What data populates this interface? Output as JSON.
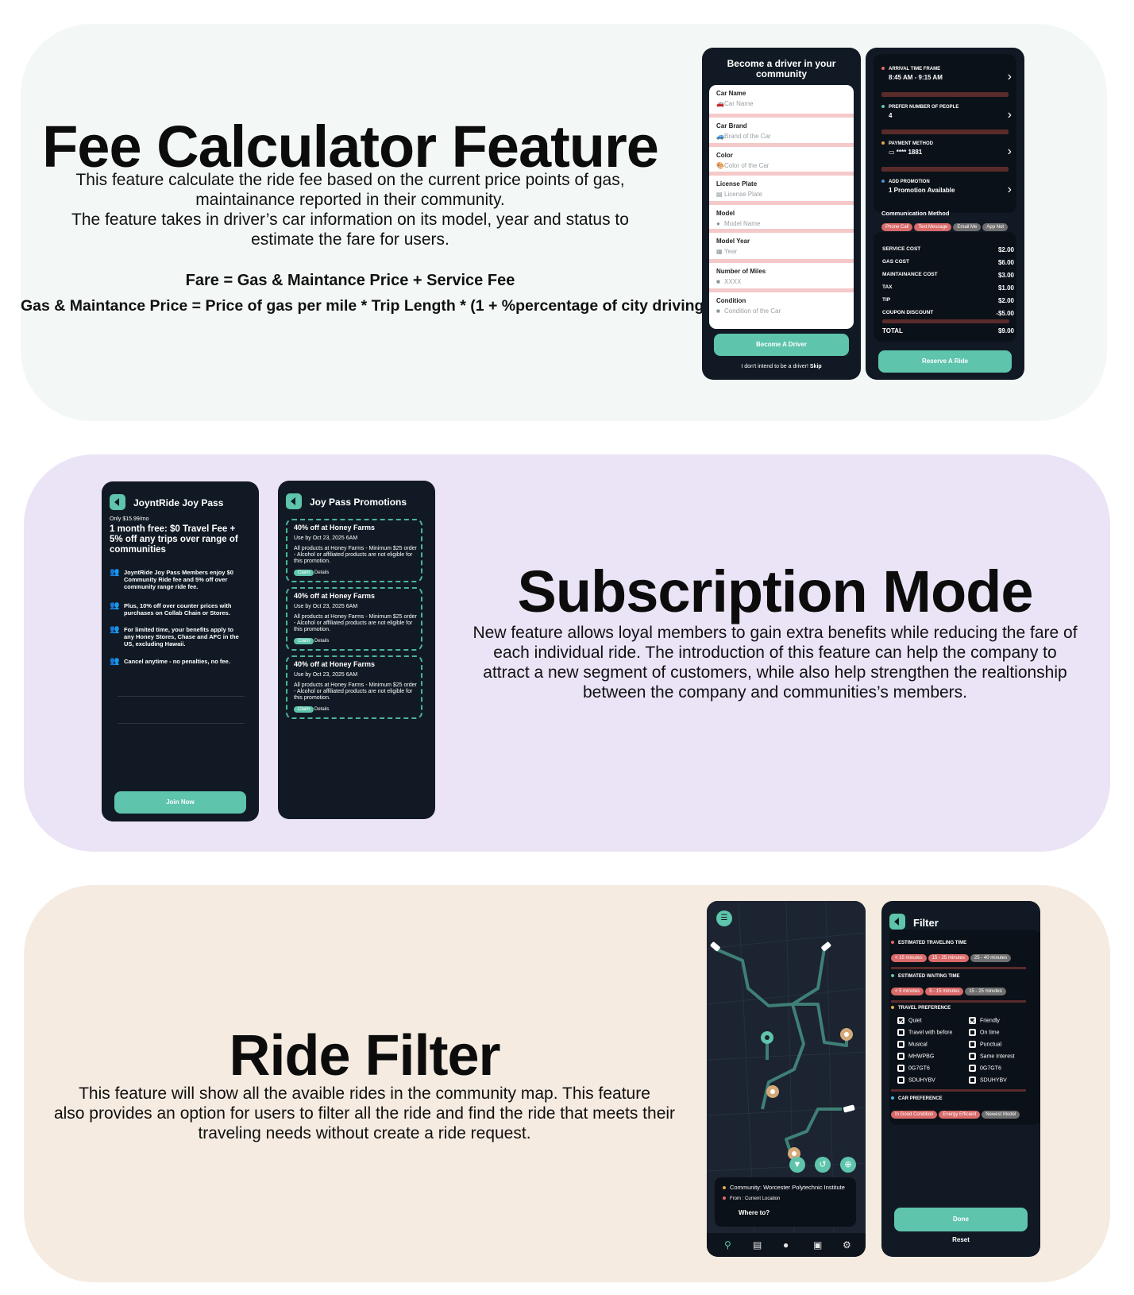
{
  "fee_section": {
    "title": "Fee Calculator Feature",
    "description_lines": [
      "This feature calculate the ride fee based on the current price points of gas,",
      "maintainance reported in their community.",
      "The feature takes in driver’s car information on its model, year and status to",
      "estimate the fare for users."
    ],
    "formula_1": "Fare = Gas & Maintance Price + Service Fee",
    "formula_2": "Gas & Maintance Price = Price of gas per mile * Trip Length * (1 + %percentage of city driving)"
  },
  "driver_phone": {
    "title": "Become a driver in your community",
    "fields": [
      {
        "label": "Car Name",
        "placeholder": "Car Name",
        "icon": "car-icon"
      },
      {
        "label": "Car Brand",
        "placeholder": "Brand of the Car",
        "icon": "car-icon"
      },
      {
        "label": "Color",
        "placeholder": "Color of the Car",
        "icon": "palette-icon"
      },
      {
        "label": "License Plate",
        "placeholder": "License Plate",
        "icon": "id-card-icon"
      },
      {
        "label": "Model",
        "placeholder": "Model Name",
        "icon": "pin-icon"
      },
      {
        "label": "Model Year",
        "placeholder": "Year",
        "icon": "calendar-icon"
      },
      {
        "label": "Number of Miles",
        "placeholder": "XXXX",
        "icon": "lock-icon"
      },
      {
        "label": "Condition",
        "placeholder": "Condition of the Car",
        "icon": "lock-icon"
      }
    ],
    "button": "Become A Driver",
    "skip_text": "I don't intend to be a driver!",
    "skip_link": "Skip"
  },
  "reserve_phone": {
    "rows": [
      {
        "label": "ARRIVAL TIME FRAME",
        "value": "8:45 AM - 9:15 AM",
        "dot_color": "#e06a6a"
      },
      {
        "label": "PREFER NUMBER OF PEOPLE",
        "value": "4",
        "dot_color": "#5ec4ac"
      },
      {
        "label": "PAYMENT METHOD",
        "value": "**** 1881",
        "dot_color": "#e6a64a"
      },
      {
        "label": "ADD PROMOTION",
        "value": "1 Promotion Available",
        "dot_color": "#4a8fd9"
      }
    ],
    "comm_title": "Communication Method",
    "comm_options": [
      "Phone Call",
      "Text Message",
      "Email Me",
      "App Not"
    ],
    "costs": [
      {
        "label": "SERVICE COST",
        "value": "$2.00"
      },
      {
        "label": "GAS COST",
        "value": "$6.00"
      },
      {
        "label": "MAINTAINANCE COST",
        "value": "$3.00"
      },
      {
        "label": "TAX",
        "value": "$1.00"
      },
      {
        "label": "TIP",
        "value": "$2.00"
      },
      {
        "label": "COUPON DISCOUNT",
        "value": "-$5.00"
      }
    ],
    "total_label": "TOTAL",
    "total_value": "$9.00",
    "button": "Reserve A Ride"
  },
  "subscription_section": {
    "title": "Subscription Mode",
    "description_lines": [
      "New feature allows loyal members to gain extra benefits while reducing the fare of",
      "each individual ride. The introduction of this feature can help the company to",
      "attract a new segment of customers, while also help strengthen the realtionship",
      "between the company and communities’s members."
    ]
  },
  "joypass_phone": {
    "title": "JoyntRide Joy Pass",
    "price": "Only $15.99/mo",
    "headline": "1 month free: $0 Travel Fee + 5% off any trips over range of communities",
    "benefits": [
      "JoyntRide Joy Pass Members enjoy $0 Community Ride fee and 5% off over community range ride fee.",
      "Plus, 10% off over counter prices with purchases on Collab Chain or Stores.",
      "For limited time, your benefits apply to any Honey Stores, Chase and AFC in the US, excluding Hawaii.",
      "Cancel anytime - no penalties, no fee."
    ],
    "button": "Join Now"
  },
  "promotions_phone": {
    "title": "Joy Pass Promotions",
    "promos": [
      {
        "title": "40% off at Honey Farms",
        "date": "Use by Oct 23, 2025 6AM",
        "body": "All products at Honey Farms - Minimum $25 order - Alcohol or affiliated products are not eligible for this promotion.",
        "claim": "Claim",
        "details": "Details"
      },
      {
        "title": "40% off at Honey Farms",
        "date": "Use by Oct 23, 2025 6AM",
        "body": "All products at Honey Farms - Minimum $25 order - Alcohol or affiliated products are not eligible for this promotion.",
        "claim": "Claim",
        "details": "Details"
      },
      {
        "title": "40% off at Honey Farms",
        "date": "Use by Oct 23, 2025 6AM",
        "body": "All products at Honey Farms - Minimum $25 order - Alcohol or affiliated products are not eligible for this promotion.",
        "claim": "Claim",
        "details": "Details"
      }
    ]
  },
  "filter_section": {
    "title": "Ride Filter",
    "description_lines": [
      "This feature will show all the avaible rides in the community map. This feature",
      "also provides an option for users to filter all the ride and find the ride that meets their",
      "traveling needs without create a ride request."
    ]
  },
  "map_phone": {
    "community": "Community: Worcester Polytechnic Institute",
    "from": "From : Current Location",
    "where_to": "Where to?"
  },
  "filter_phone": {
    "title": "Filter",
    "travel_time_title": "ESTIMATED TRAVELING TIME",
    "travel_time_options": [
      "< 15 minutes",
      "15 - 25 minutes",
      "25 - 40 minutes"
    ],
    "wait_time_title": "ESTIMATED WAITING TIME",
    "wait_time_options": [
      "< 5 minutes",
      "5 - 15 minutes",
      "15 - 25 minutes"
    ],
    "travel_pref_title": "TRAVEL PREFERENCE",
    "travel_pref_left": [
      {
        "label": "Quiet",
        "checked": true
      },
      {
        "label": "Travel with before",
        "checked": false
      },
      {
        "label": "Musical",
        "checked": false
      },
      {
        "label": "MHWPBG",
        "checked": false
      },
      {
        "label": "0G7GT6",
        "checked": false
      },
      {
        "label": "SDUHYBV",
        "checked": false
      }
    ],
    "travel_pref_right": [
      {
        "label": "Friendly",
        "checked": true
      },
      {
        "label": "On time",
        "checked": false
      },
      {
        "label": "Punctual",
        "checked": false
      },
      {
        "label": "Same Interest",
        "checked": false
      },
      {
        "label": "0G7GT6",
        "checked": false
      },
      {
        "label": "SDUHYBV",
        "checked": false
      }
    ],
    "car_pref_title": "CAR PREFERENCE",
    "car_pref_options": [
      "In Good Condition",
      "Energy Efficient",
      "Newest Model"
    ],
    "done": "Done",
    "reset": "Reset"
  },
  "colors": {
    "mint": "#5ec4ac",
    "phone_bg": "#111a24",
    "fee_bg": "#f3f8f7",
    "sub_bg": "#ebe3f6",
    "filter_bg": "#f5ebe0"
  }
}
